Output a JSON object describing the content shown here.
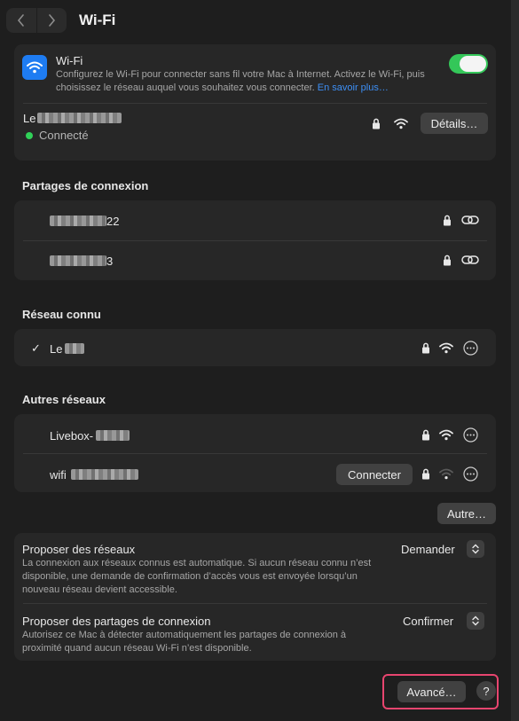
{
  "header": {
    "title": "Wi-Fi"
  },
  "wifi": {
    "label": "Wi-Fi",
    "description": "Configurez le Wi-Fi pour connecter sans fil votre Mac à Internet. Activez le Wi-Fi, puis choisissez le réseau auquel vous souhaitez vous connecter.",
    "link": "En savoir plus…",
    "enabled": true
  },
  "current": {
    "name_prefix": "Le",
    "status": "Connecté",
    "details_label": "Détails…"
  },
  "hotspots": {
    "heading": "Partages de connexion",
    "items": [
      {
        "suffix": "22"
      },
      {
        "suffix": "3"
      }
    ]
  },
  "known": {
    "heading": "Réseau connu",
    "check": "✓",
    "items": [
      {
        "prefix": "Le"
      }
    ]
  },
  "others": {
    "heading": "Autres réseaux",
    "items": [
      {
        "prefix": "Livebox-"
      },
      {
        "prefix": "wifi",
        "connect_label": "Connecter"
      }
    ],
    "more_label": "Autre…"
  },
  "settings": {
    "ask_networks": {
      "label": "Proposer des réseaux",
      "description": "La connexion aux réseaux connus est automatique. Si aucun réseau connu n’est disponible, une demande de confirmation d’accès vous est envoyée lorsqu’un nouveau réseau devient accessible.",
      "value": "Demander"
    },
    "ask_hotspots": {
      "label": "Proposer des partages de connexion",
      "description": "Autorisez ce Mac à détecter automatiquement les partages de connexion à proximité quand aucun réseau Wi-Fi n’est disponible.",
      "value": "Confirmer"
    }
  },
  "footer": {
    "advanced_label": "Avancé…",
    "help_label": "?"
  },
  "colors": {
    "accent": "#3d8ff5",
    "toggle_on": "#34c759",
    "connected": "#30d158",
    "highlight": "#e8456f"
  }
}
